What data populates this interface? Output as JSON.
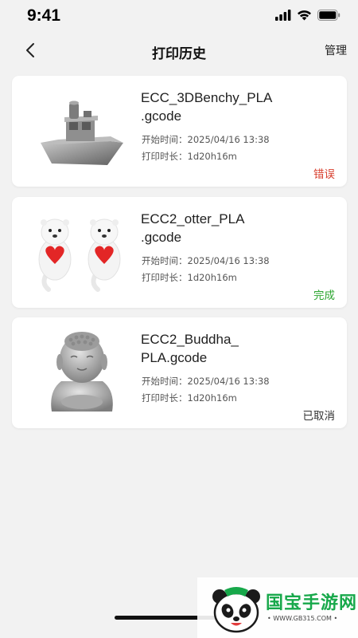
{
  "status_bar": {
    "time": "9:41"
  },
  "nav": {
    "title": "打印历史",
    "manage_label": "管理"
  },
  "records": [
    {
      "file_line1": "ECC_3DBenchy_PLA",
      "file_line2": ".gcode",
      "start_time": "开始时间：2025/04/16 13:38",
      "duration": "打印时长：1d20h16m",
      "status": "错误",
      "status_color": "#d8402f",
      "thumbnail": "boat-model-icon"
    },
    {
      "file_line1": "ECC2_otter_PLA",
      "file_line2": ".gcode",
      "start_time": "开始时间：2025/04/16 13:38",
      "duration": "打印时长：1d20h16m",
      "status": "完成",
      "status_color": "#2ba52f",
      "thumbnail": "otter-model-icon"
    },
    {
      "file_line1": "ECC2_Buddha_",
      "file_line2": "PLA.gcode",
      "start_time": "开始时间：2025/04/16 13:38",
      "duration": "打印时长：1d20h16m",
      "status": "已取消",
      "status_color": "#333333",
      "thumbnail": "buddha-model-icon"
    }
  ],
  "watermark": {
    "text": "国宝手游网",
    "url": "• WWW.GB315.COM •",
    "logo": "panda-logo-icon"
  }
}
